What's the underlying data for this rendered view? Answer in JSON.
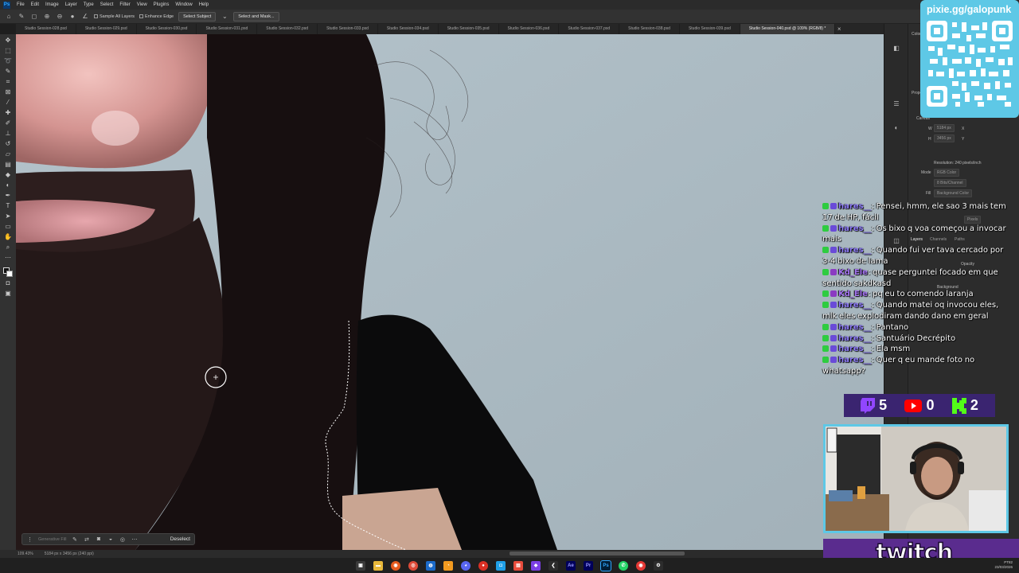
{
  "menubar": {
    "logo": "Ps",
    "items": [
      "File",
      "Edit",
      "Image",
      "Layer",
      "Type",
      "Select",
      "Filter",
      "View",
      "Plugins",
      "Window",
      "Help"
    ]
  },
  "options": {
    "sample_all_layers": "Sample All Layers",
    "enhance_edge": "Enhance Edge",
    "select_subject": "Select Subject",
    "select_and_mask": "Select and Mask..."
  },
  "tabs": [
    "Studio Session-028.psd",
    "Studio Session-029.psd",
    "Studio Session-030.psd",
    "Studio Session-031.psd",
    "Studio Session-032.psd",
    "Studio Session-033.psd",
    "Studio Session-034.psd",
    "Studio Session-035.psd",
    "Studio Session-036.psd",
    "Studio Session-037.psd",
    "Studio Session-038.psd",
    "Studio Session-039.psd",
    "Studio Session-040.psd @ 109% (RGB/8) *"
  ],
  "context_bar": {
    "generative_fill": "Generative Fill",
    "deselect": "Deselect"
  },
  "status": {
    "zoom": "109.43%",
    "doc_size": "5184 px x 3456 px (240 ppi)"
  },
  "right_panel": {
    "color_tab": "Color",
    "properties_tab": "Prope",
    "canvas_section": "Canvas",
    "width_label": "W",
    "width_value": "5184 px",
    "height_label": "H",
    "height_value": "3456 px",
    "x_label": "X",
    "y_label": "Y",
    "resolution": "Resolution: 240 pixels/inch",
    "mode_label": "Mode",
    "mode_value": "RGB Color",
    "bits_value": "8 Bits/Channel",
    "fill_label": "Fill",
    "fill_value": "Background Color",
    "pixels": "Pixels",
    "layers_tab": "Layers",
    "channels_tab": "Channels",
    "paths_tab": "Paths",
    "opacity": "Opacity",
    "background_layer": "Background"
  },
  "overlay": {
    "qr_url": "pixie.gg/galopunk",
    "chat": [
      {
        "user": "hares__",
        "text": "Pensei, hmm, ele sao 3 mais tem 17 de HP, fácil"
      },
      {
        "user": "hares__",
        "text": "Os bixo q voa começou a invocar mais"
      },
      {
        "user": "hares__",
        "text": "Quando fui ver tava cercado por 3-4 bixo de lama"
      },
      {
        "user": "Kd_Ele",
        "text": "quase perguntei focado em que sentido sakdkasd"
      },
      {
        "user": "Kd_Ele",
        "text": "pq eu to comendo laranja"
      },
      {
        "user": "hares__",
        "text": "Quando matei oq invocou eles, mlk eles explodiram dando dano em geral"
      },
      {
        "user": "hares__",
        "text": "Pantano"
      },
      {
        "user": "hares__",
        "text": "Santuário Decrépito"
      },
      {
        "user": "hares__",
        "text": "Ela msm"
      },
      {
        "user": "hares__",
        "text": "Quer q eu mande foto no whatsapp?"
      }
    ],
    "counters": [
      {
        "platform": "twitch",
        "count": "5",
        "color": "#9146ff"
      },
      {
        "platform": "youtube",
        "count": "0",
        "color": "#ff0000"
      },
      {
        "platform": "kick",
        "count": "2",
        "color": "#53fc18"
      }
    ],
    "twitch_banner": "twitch"
  },
  "taskbar": {
    "time": "PT82",
    "date": "23/03/2026",
    "apps": [
      "Ae",
      "Pr",
      "Ps"
    ]
  }
}
